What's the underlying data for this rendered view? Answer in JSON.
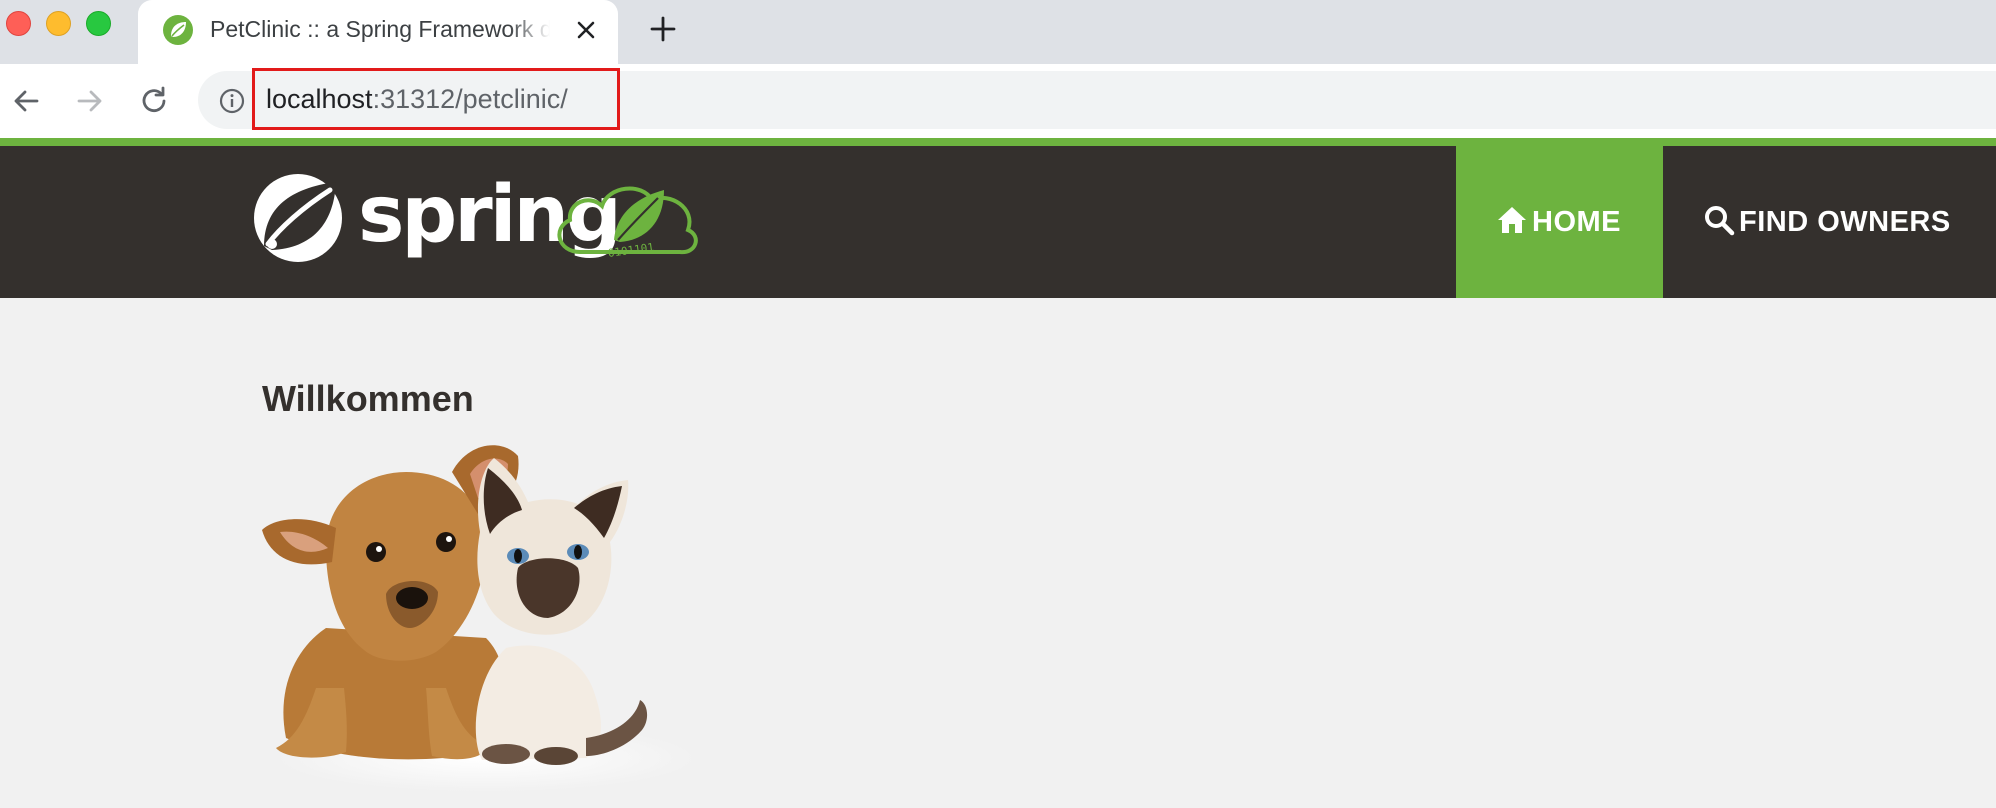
{
  "browser": {
    "tab_title": "PetClinic :: a Spring Framework demonstration",
    "url_host": "localhost",
    "url_rest": ":31312/petclinic/"
  },
  "navbar": {
    "brand": "spring",
    "cloud_digits": "0101101",
    "items": [
      {
        "label": "HOME",
        "icon": "home-icon",
        "active": true
      },
      {
        "label": "FIND OWNERS",
        "icon": "search-icon",
        "active": false
      }
    ]
  },
  "main": {
    "heading": "Willkommen",
    "image": "pets-image"
  },
  "colors": {
    "accent": "#6db33f",
    "navbar": "#34302d",
    "highlight": "#e21a1a"
  }
}
